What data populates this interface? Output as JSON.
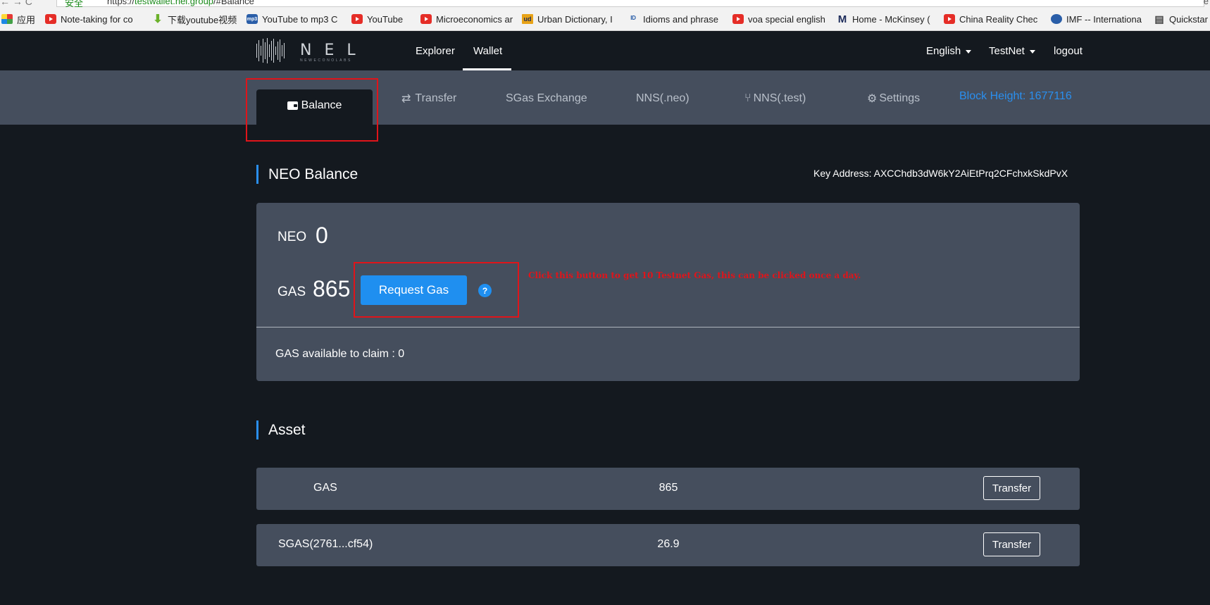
{
  "browser": {
    "nav_glyphs": "← → C",
    "secure_label": "安全",
    "url_scheme": "https://",
    "url_host": "testwallet.nel.group",
    "url_path": "/#Balance",
    "right_glyph": "e"
  },
  "bookmarks": [
    {
      "label": "应用",
      "icon": "apps-icon"
    },
    {
      "label": "Note-taking for co",
      "icon": "youtube-icon"
    },
    {
      "label": "下载youtube视频",
      "icon": "download-icon"
    },
    {
      "label": "YouTube to mp3 C",
      "icon": "mp3-icon"
    },
    {
      "label": "YouTube",
      "icon": "youtube-icon"
    },
    {
      "label": "Microeconomics ar",
      "icon": "youtube-icon"
    },
    {
      "label": "Urban Dictionary, I",
      "icon": "urban-dictionary-icon"
    },
    {
      "label": "Idioms and phrase",
      "icon": "idioms-icon"
    },
    {
      "label": "voa special english",
      "icon": "youtube-icon"
    },
    {
      "label": "Home - McKinsey (",
      "icon": "mckinsey-icon"
    },
    {
      "label": "China Reality Chec",
      "icon": "youtube-icon"
    },
    {
      "label": "IMF -- Internationa",
      "icon": "imf-icon"
    },
    {
      "label": "Quickstar",
      "icon": "quickstart-icon"
    }
  ],
  "header": {
    "logo_text": "NEL",
    "logo_tagline": "NEWECONOLABS",
    "nav": {
      "explorer": "Explorer",
      "wallet": "Wallet"
    },
    "language": "English",
    "network": "TestNet",
    "logout": "logout"
  },
  "tabs": {
    "balance": "Balance",
    "transfer": "Transfer",
    "sgas_exchange": "SGas Exchange",
    "nns_neo": "NNS(.neo)",
    "nns_test": "NNS(.test)",
    "settings": "Settings",
    "block_height": "Block Height:  1677116"
  },
  "balance": {
    "title": "NEO Balance",
    "key_address": "Key Address:  AXCChdb3dW6kY2AiEtPrq2CFchxkSkdPvX",
    "neo_label": "NEO",
    "neo_value": "0",
    "gas_label": "GAS",
    "gas_value": "865",
    "request_gas": "Request Gas",
    "help": "?",
    "claim_text": "GAS available to claim : 0",
    "annotation": "Click this button to get 10 Testnet Gas, this can be clicked once a day."
  },
  "assets": {
    "title": "Asset",
    "rows": [
      {
        "name": "GAS",
        "amount": "865",
        "action": "Transfer"
      },
      {
        "name": "SGAS(2761...cf54)",
        "amount": "26.9",
        "action": "Transfer"
      }
    ]
  },
  "colors": {
    "page_bg": "#14191f",
    "panel_bg": "#454e5d",
    "accent_blue": "#1f8ff0",
    "annotation_red": "#e0141a"
  }
}
